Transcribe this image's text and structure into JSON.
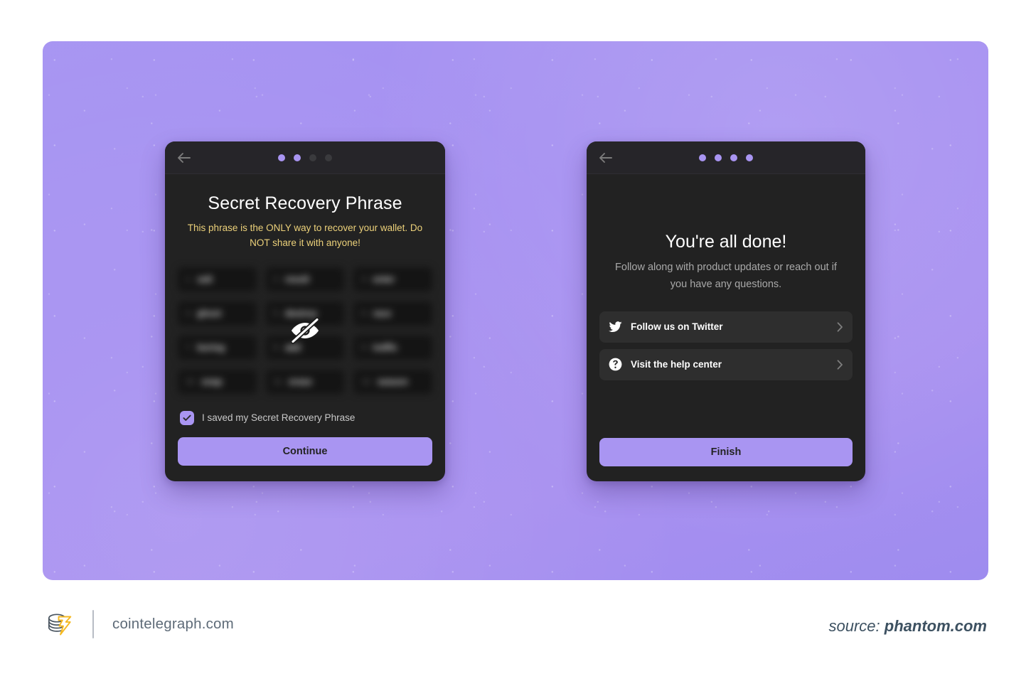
{
  "footer": {
    "brand_name": "cointelegraph.com",
    "logo_icon": "cointelegraph-coins-bolt-icon",
    "source_label": "source:",
    "source_value": "phantom.com"
  },
  "colors": {
    "background_purple": "#a590f1",
    "card_background": "#222222",
    "card_header": "#262529",
    "accent_purple": "#a995f2",
    "warning_yellow": "#ecd17a",
    "row_background": "#2e2e2e",
    "footer_text": "#5e6b78",
    "source_text": "#3d5161"
  },
  "left_panel": {
    "back_icon": "back-arrow-icon",
    "step_dots": [
      {
        "active": true
      },
      {
        "active": true
      },
      {
        "active": false
      },
      {
        "active": false
      }
    ],
    "title": "Secret Recovery Phrase",
    "warning": "This phrase is the ONLY way to recover your wallet. Do NOT share it with anyone!",
    "hidden_icon": "eye-slash-icon",
    "seed_words": [
      {
        "number": "1.",
        "word": "salt"
      },
      {
        "number": "2.",
        "word": "result"
      },
      {
        "number": "3.",
        "word": "enter"
      },
      {
        "number": "4.",
        "word": "ghost"
      },
      {
        "number": "5.",
        "word": "destroy"
      },
      {
        "number": "6.",
        "word": "race"
      },
      {
        "number": "7.",
        "word": "boring"
      },
      {
        "number": "8.",
        "word": "add"
      },
      {
        "number": "9.",
        "word": "traffic"
      },
      {
        "number": "10.",
        "word": "snap"
      },
      {
        "number": "11.",
        "word": "erase"
      },
      {
        "number": "12.",
        "word": "season"
      }
    ],
    "checkbox_checked": true,
    "checkbox_icon": "checkmark-icon",
    "checkbox_label": "I saved my Secret Recovery Phrase",
    "continue_label": "Continue"
  },
  "right_panel": {
    "back_icon": "back-arrow-icon",
    "step_dots": [
      {
        "active": true
      },
      {
        "active": true
      },
      {
        "active": true
      },
      {
        "active": true
      }
    ],
    "title": "You're all done!",
    "subtitle": "Follow along with product updates or reach out if you have any questions.",
    "links": [
      {
        "icon": "twitter-icon",
        "label": "Follow us on Twitter",
        "chevron": "chevron-right-icon"
      },
      {
        "icon": "question-mark-circle-icon",
        "label": "Visit the help center",
        "chevron": "chevron-right-icon"
      }
    ],
    "finish_label": "Finish"
  }
}
